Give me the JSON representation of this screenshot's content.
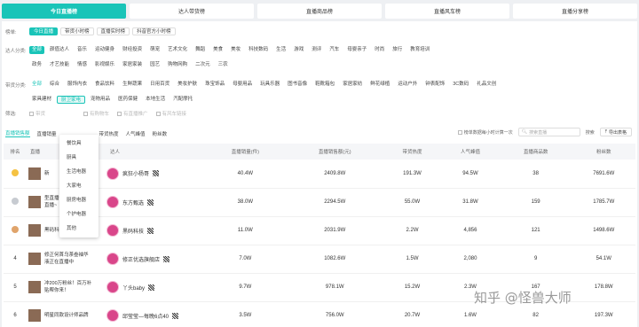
{
  "top_tabs": [
    "今日直播榜",
    "达人带货榜",
    "直播商品榜",
    "直播风车榜",
    "直播分享榜"
  ],
  "rank_filter": {
    "label": "榜单:",
    "options": [
      "今日直播",
      "带货小时榜",
      "直播实时榜",
      "抖音官方小时榜"
    ],
    "active": 0
  },
  "talent_filter": {
    "label": "达人分类:",
    "row1": [
      "全部",
      "颜值达人",
      "音乐",
      "运动健身",
      "财经投资",
      "萌宠",
      "艺术文化",
      "舞蹈",
      "美食",
      "美妆",
      "科技数码",
      "生活",
      "游戏",
      "测评",
      "汽车",
      "母婴亲子",
      "时尚",
      "旅行",
      "教育培训"
    ],
    "row2": [
      "政务",
      "才艺技能",
      "情感",
      "影视娱乐",
      "家居家装",
      "园艺",
      "购物网购",
      "二次元",
      "三农"
    ],
    "active": 0
  },
  "goods_filter": {
    "label": "带货分类:",
    "row1": [
      "全部",
      "综合",
      "服饰内衣",
      "食品饮料",
      "生鲜蔬果",
      "日用百货",
      "美妆护肤",
      "珠宝饰品",
      "母婴用品",
      "玩具乐器",
      "图书音像",
      "鞋靴箱包",
      "家居家纺",
      "鲜花绿植",
      "运动户外",
      "钟表配饰",
      "3C数码",
      "礼品文创"
    ],
    "row2": [
      "家具建材",
      "厨卫家电",
      "宠物用品",
      "医药保健",
      "本地生活",
      "汽配摩托"
    ],
    "active": 0,
    "hover": "厨卫家电"
  },
  "filter_row": {
    "label": "筛选:",
    "options": [
      "带货",
      "有购物车",
      "有直播推广",
      "有风车链接"
    ]
  },
  "sub_tabs": [
    "直播销售额",
    "直播销量",
    "带货热度",
    "人气峰值",
    "粉丝数"
  ],
  "dropdown": [
    "餐饮具",
    "厨具",
    "生活电器",
    "大家电",
    "厨房电器",
    "个护电器",
    "其他"
  ],
  "tools": {
    "checkbox_label": "榜单数据每小时计算一次",
    "search_placeholder": "搜索直播",
    "search_button": "搜索",
    "export_button": "导出表格"
  },
  "table": {
    "headers": [
      "排名",
      "直播",
      "达人",
      "直播销量(件)",
      "直播销售额(元)",
      "带货热度",
      "人气峰值",
      "直播商品数",
      "粉丝数"
    ],
    "rows": [
      {
        "rank": "",
        "medal": "gold",
        "live_title": "新",
        "host": "疯狂小杨哥",
        "sales": "40.4W",
        "revenue": "2409.8W",
        "heat": "191.3W",
        "peak": "94.5W",
        "goods": "38",
        "fans": "7691.6W"
      },
      {
        "rank": "",
        "medal": "silver",
        "live_title": "型直播间，鲜美生活直播~",
        "host": "东方甄选",
        "sales": "38.0W",
        "revenue": "2294.5W",
        "heat": "55.0W",
        "peak": "31.8W",
        "goods": "159",
        "fans": "1785.7W"
      },
      {
        "rank": "",
        "medal": "bronze",
        "live_title": "黑码科技正在直播",
        "host": "黑码科技",
        "sales": "11.0W",
        "revenue": "2031.9W",
        "heat": "2.2W",
        "peak": "4,856",
        "goods": "121",
        "fans": "1498.6W"
      },
      {
        "rank": "4",
        "medal": "",
        "live_title": "修正何首乌茶叁袖华液正在直播中",
        "host": "修正优选旗舰店",
        "sales": "7.0W",
        "revenue": "1082.6W",
        "heat": "1.5W",
        "peak": "2,080",
        "goods": "9",
        "fans": "54.1W"
      },
      {
        "rank": "5",
        "medal": "",
        "live_title": "冲200万粉丝！百万补贴帮你来！",
        "host": "丫头baby",
        "sales": "9.7W",
        "revenue": "978.1W",
        "heat": "15.2W",
        "peak": "2.3W",
        "goods": "167",
        "fans": "178.8W"
      },
      {
        "rank": "6",
        "medal": "",
        "live_title": "明星同款设计师品牌",
        "host": "邱莹莹—每晚6点40",
        "sales": "3.5W",
        "revenue": "756.0W",
        "heat": "20.7W",
        "peak": "1.6W",
        "goods": "82",
        "fans": "197.3W"
      }
    ]
  },
  "watermark": "知乎 @怪兽大师",
  "colors": {
    "accent": "#19c4b8"
  }
}
